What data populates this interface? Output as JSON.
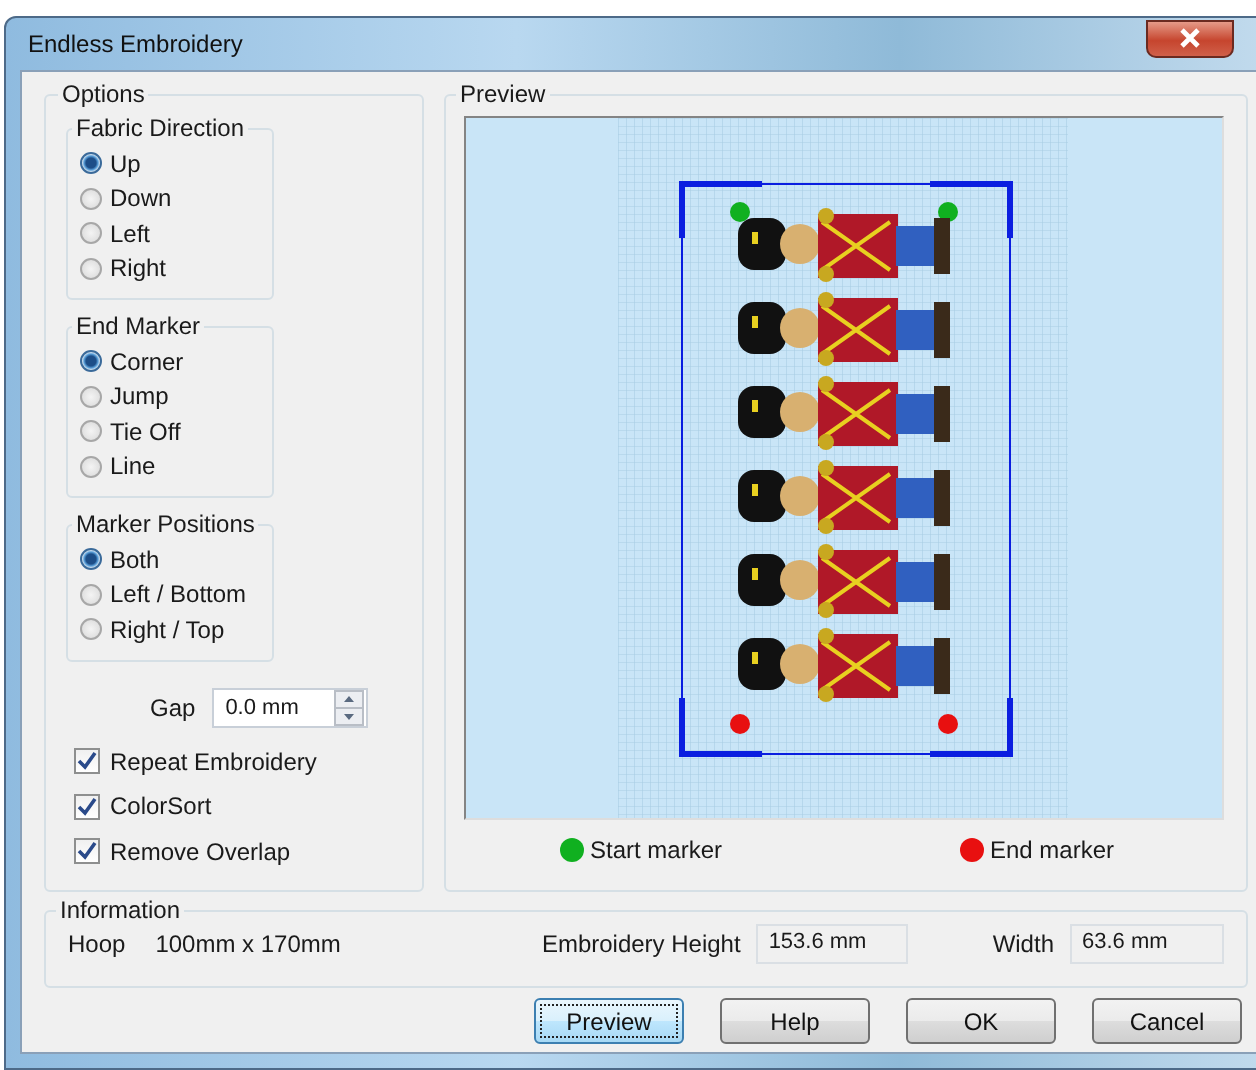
{
  "window": {
    "title": "Endless Embroidery"
  },
  "options": {
    "title": "Options",
    "groups": [
      {
        "title": "Fabric Direction",
        "items": [
          {
            "label": "Up",
            "selected": true
          },
          {
            "label": "Down",
            "selected": false
          },
          {
            "label": "Left",
            "selected": false
          },
          {
            "label": "Right",
            "selected": false
          }
        ]
      },
      {
        "title": "End Marker",
        "items": [
          {
            "label": "Corner",
            "selected": true
          },
          {
            "label": "Jump",
            "selected": false
          },
          {
            "label": "Tie Off",
            "selected": false
          },
          {
            "label": "Line",
            "selected": false
          }
        ]
      },
      {
        "title": "Marker Positions",
        "items": [
          {
            "label": "Both",
            "selected": true
          },
          {
            "label": "Left / Bottom",
            "selected": false
          },
          {
            "label": "Right / Top",
            "selected": false
          }
        ]
      }
    ],
    "gap": {
      "label": "Gap",
      "value": "0.0 mm"
    },
    "checkboxes": [
      {
        "label": "Repeat Embroidery",
        "checked": true
      },
      {
        "label": "ColorSort",
        "checked": true
      },
      {
        "label": "Remove Overlap",
        "checked": true
      }
    ]
  },
  "preview": {
    "title": "Preview",
    "legend": [
      {
        "label": "Start marker",
        "color": "#10b020"
      },
      {
        "label": "End marker",
        "color": "#e81010"
      }
    ]
  },
  "information": {
    "title": "Information",
    "hoop_label": "Hoop",
    "hoop_value": "100mm x 170mm",
    "height_label": "Embroidery Height",
    "height_value": "153.6 mm",
    "width_label": "Width",
    "width_value": "63.6 mm"
  },
  "buttons": [
    {
      "label": "Preview",
      "focused": true
    },
    {
      "label": "Help",
      "focused": false
    },
    {
      "label": "OK",
      "focused": false
    },
    {
      "label": "Cancel",
      "focused": false
    }
  ]
}
